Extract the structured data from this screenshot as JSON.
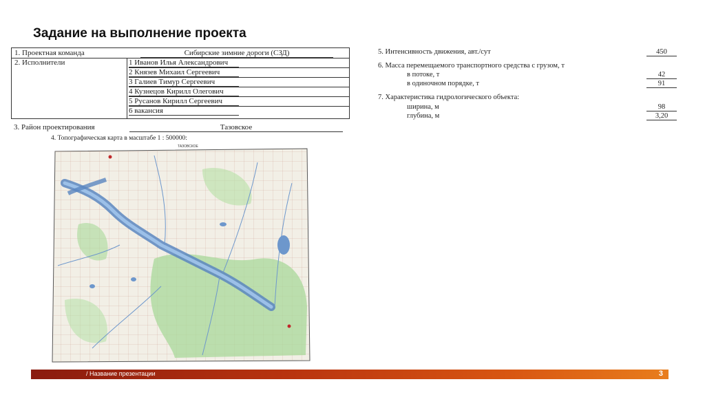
{
  "title": "Задание на выполнение проекта",
  "table": {
    "row1_label": "1. Проектная команда",
    "row1_value": "Сибирские зимние дороги (СЗД)",
    "row2_label": "2. Исполнители",
    "executors": [
      "1 Иванов Илья Александрович",
      "2 Князев Михаил Сергеевич",
      "3 Галиев Тимур Сергеевич",
      "4 Кузнецов Кирилл Олегович",
      "5 Русанов Кирилл Сергеевич",
      "6 вакансия"
    ],
    "row3_label": "3. Район проектирования",
    "row3_value": "Тазовское"
  },
  "map": {
    "caption": "4. Топографическая карта в масштабе 1 : 500000:",
    "header_text": "ТАЗОВСКОЕ"
  },
  "right": {
    "item5_label": "5. Интенсивность движения, авт./сут",
    "item5_value": "450",
    "item6_label": "6. Масса перемещаемого транспортного средства с грузом, т",
    "item6_sub1_label": "в потоке, т",
    "item6_sub1_value": "42",
    "item6_sub2_label": "в одиночном порядке, т",
    "item6_sub2_value": "91",
    "item7_label": "7. Характеристика гидрологического объекта:",
    "item7_sub1_label": "ширина, м",
    "item7_sub1_value": "98",
    "item7_sub2_label": "глубина, м",
    "item7_sub2_value": "3,20"
  },
  "footer": {
    "text": "/ Название презентации",
    "page_number": "3",
    "gradient_colors": [
      "#8a1b0f",
      "#e87d1c"
    ]
  }
}
